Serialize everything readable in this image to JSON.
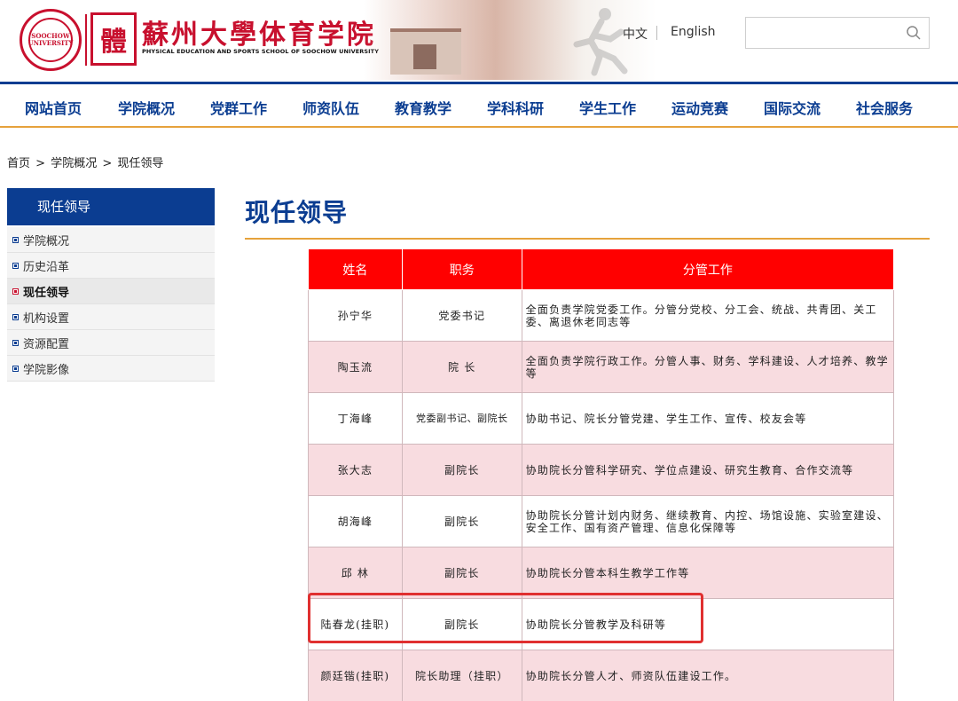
{
  "header": {
    "seal_text": [
      "SOOCHOW",
      "UNIVERSITY"
    ],
    "logo_mark": "體",
    "title": "蘇州大學体育学院",
    "subtitle": "PHYSICAL EDUCATION AND SPORTS SCHOOL OF SOOCHOW UNIVERSITY",
    "lang_zh": "中文",
    "lang_en": "English",
    "search_placeholder": ""
  },
  "nav": {
    "items": [
      "网站首页",
      "学院概况",
      "党群工作",
      "师资队伍",
      "教育教学",
      "学科科研",
      "学生工作",
      "运动竞赛",
      "国际交流",
      "社会服务"
    ]
  },
  "breadcrumb": {
    "home": "首页",
    "sep1": ">",
    "section": "学院概况",
    "sep2": ">",
    "current": "现任领导"
  },
  "sidebar": {
    "heading": "现任领导",
    "items": [
      {
        "label": "学院概况",
        "active": false
      },
      {
        "label": "历史沿革",
        "active": false
      },
      {
        "label": "现任领导",
        "active": true
      },
      {
        "label": "机构设置",
        "active": false
      },
      {
        "label": "资源配置",
        "active": false
      },
      {
        "label": "学院影像",
        "active": false
      }
    ]
  },
  "main": {
    "title": "现任领导",
    "table": {
      "headers": [
        "姓名",
        "职务",
        "分管工作"
      ],
      "rows": [
        {
          "name": "孙宁华",
          "title": "党委书记",
          "duty": "全面负责学院党委工作。分管分党校、分工会、统战、共青团、关工委、离退休老同志等"
        },
        {
          "name": "陶玉流",
          "title": "院 长",
          "duty": "全面负责学院行政工作。分管人事、财务、学科建设、人才培养、教学等"
        },
        {
          "name": "丁海峰",
          "title": "党委副书记、副院长",
          "duty": "协助书记、院长分管党建、学生工作、宣传、校友会等"
        },
        {
          "name": "张大志",
          "title": "副院长",
          "duty": "协助院长分管科学研究、学位点建设、研究生教育、合作交流等"
        },
        {
          "name": "胡海峰",
          "title": "副院长",
          "duty": "协助院长分管计划内财务、继续教育、内控、场馆设施、实验室建设、安全工作、国有资产管理、信息化保障等"
        },
        {
          "name": "邱 林",
          "title": "副院长",
          "duty": "协助院长分管本科生教学工作等"
        },
        {
          "name": "陆春龙(挂职)",
          "title": "副院长",
          "duty": "协助院长分管教学及科研等"
        },
        {
          "name": "颜廷锴(挂职)",
          "title": "院长助理（挂职）",
          "duty": "协助院长分管人才、师资队伍建设工作。"
        }
      ]
    }
  },
  "colors": {
    "brand_blue": "#0b3d91",
    "brand_red": "#c8102e",
    "table_header": "#ff0000",
    "row_pink": "#f8dce0",
    "accent_orange": "#e6a23c",
    "highlight_red": "#e03030"
  }
}
